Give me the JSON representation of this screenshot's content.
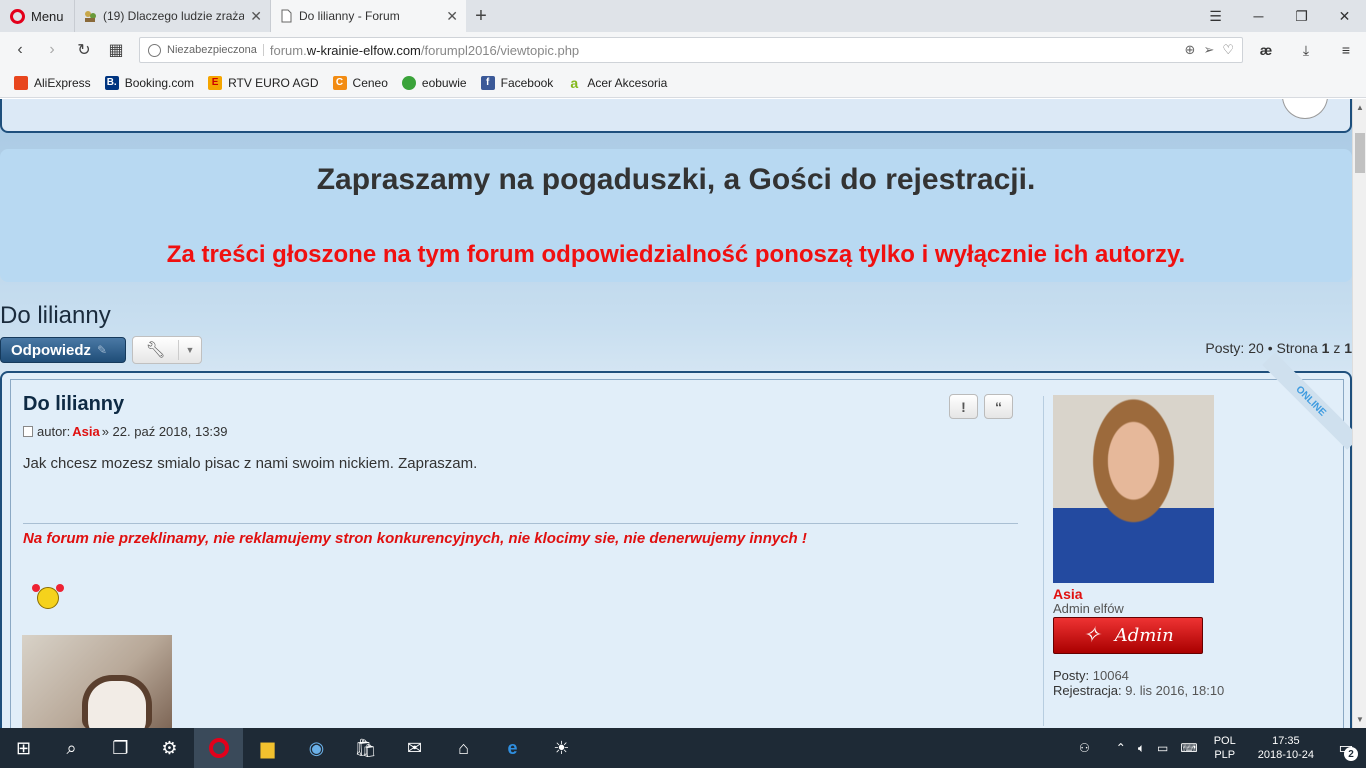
{
  "browser": {
    "menu_label": "Menu",
    "tabs": [
      {
        "title": "(19) Dlaczego ludzie zraża",
        "icon": "people-icon",
        "active": false
      },
      {
        "title": "Do lilianny - Forum",
        "icon": "page-icon",
        "active": true
      }
    ],
    "address": {
      "security_label": "Niezabezpieczona",
      "url_prefix": "forum.",
      "url_domain": "w-krainie-elfow.com",
      "url_path": "/forumpl2016/viewtopic.php"
    },
    "ext_label": "æ",
    "bookmarks": [
      {
        "label": "AliExpress",
        "color": "#e8461e",
        "glyph": ""
      },
      {
        "label": "Booking.com",
        "color": "#003580",
        "glyph": "B."
      },
      {
        "label": "RTV EURO AGD",
        "color": "#f5a500",
        "glyph": "E"
      },
      {
        "label": "Ceneo",
        "color": "#f28c13",
        "glyph": "C"
      },
      {
        "label": "eobuwie",
        "color": "#3aa33a",
        "glyph": ""
      },
      {
        "label": "Facebook",
        "color": "#3b5998",
        "glyph": "f"
      },
      {
        "label": "Acer Akcesoria",
        "color": "#83b81a",
        "glyph": "a"
      }
    ]
  },
  "forum": {
    "banner_title": "Zapraszamy na pogaduszki, a Gości do rejestracji.",
    "banner_notice": "Za treści głoszone na tym forum odpowiedzialność ponoszą tylko i wyłącznie ich autorzy.",
    "topic_title": "Do lilianny",
    "reply_button": "Odpowiedz",
    "pagination": {
      "posts_label": "Posty:",
      "posts_count": "20",
      "page_label": "Strona",
      "page_current": "1",
      "page_of": "z",
      "page_total": "1"
    },
    "post": {
      "title": "Do lilianny",
      "author_prefix": "autor:",
      "author": "Asia",
      "date": "» 22. paź 2018, 13:39",
      "body": "Jak chcesz mozesz smialo pisac z nami swoim nickiem. Zapraszam.",
      "signature": "Na forum nie przeklinamy, nie reklamujemy stron konkurencyjnych, nie klocimy sie, nie denerwujemy innych !",
      "report_label": "!",
      "quote_label": "“"
    },
    "profile": {
      "name": "Asia",
      "rank": "Admin elfów",
      "rank_badge": "Admin",
      "posts_label": "Posty:",
      "posts_value": "10064",
      "registered_label": "Rejestracja:",
      "registered_value": "9. lis 2016, 18:10",
      "status": "ONLINE"
    }
  },
  "taskbar": {
    "lang_top": "POL",
    "lang_bottom": "PLP",
    "time": "17:35",
    "date": "2018-10-24",
    "notifications": "2"
  }
}
